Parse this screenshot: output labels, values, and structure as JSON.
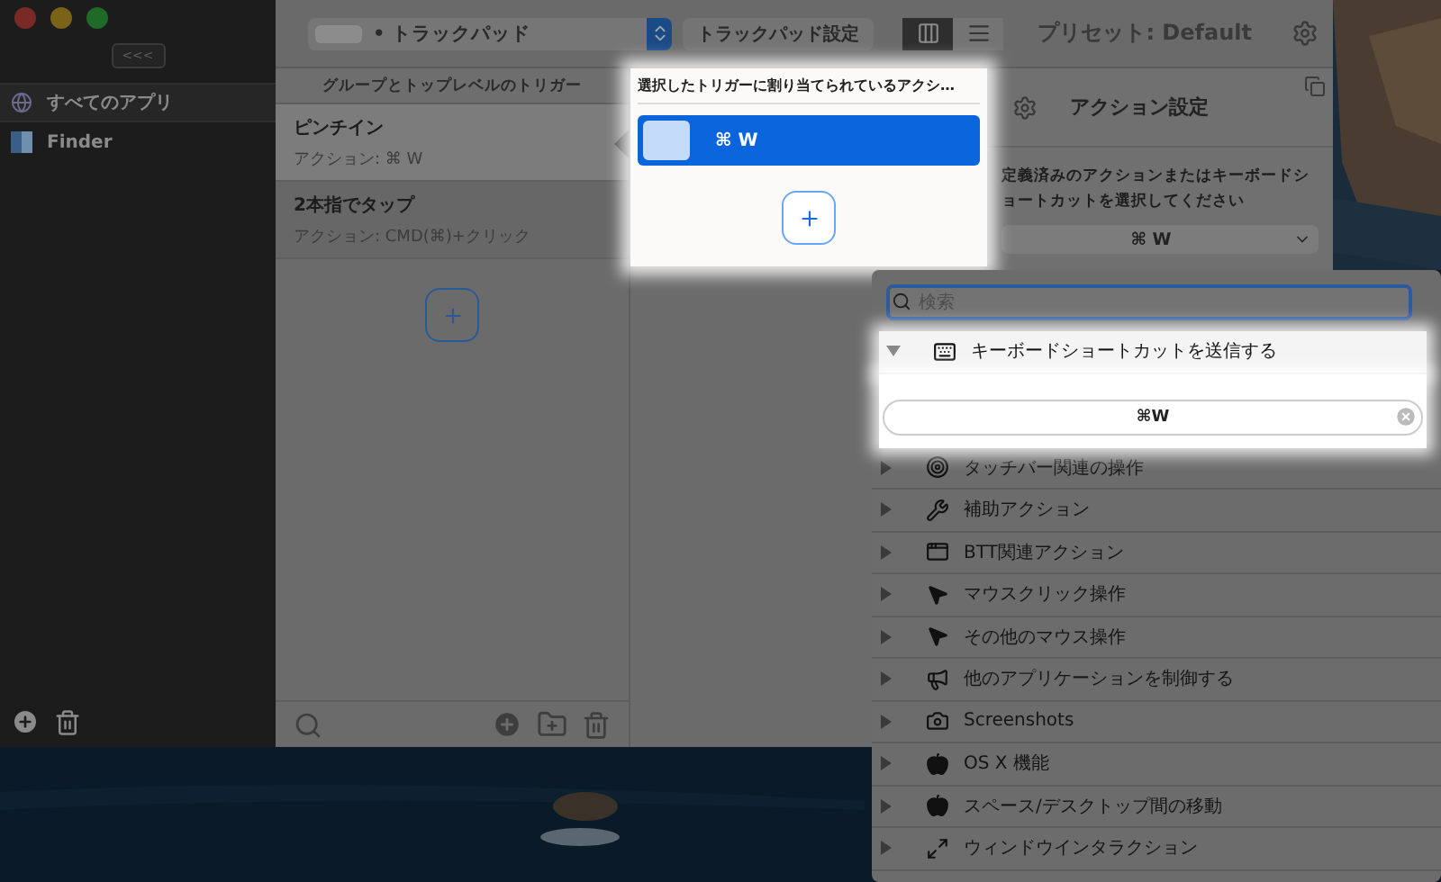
{
  "sidebar": {
    "collapse_button": "<<<",
    "items": [
      {
        "label": "すべてのアプリ",
        "kind": "globe",
        "selected": true
      },
      {
        "label": "Finder",
        "kind": "app",
        "selected": false
      }
    ]
  },
  "toolbar": {
    "device": "• トラックパッド",
    "settings_button": "トラックパッド設定",
    "view_modes": [
      {
        "kind": "columns",
        "selected": true
      },
      {
        "kind": "list",
        "selected": false
      }
    ],
    "preset": "プリセット: Default"
  },
  "triggers": {
    "header": "グループとトップレベルのトリガー",
    "items": [
      {
        "title": "ピンチイン",
        "action": "アクション: ⌘ W",
        "selected": true
      },
      {
        "title": "2本指でタップ",
        "action": "アクション: CMD(⌘)+クリック",
        "selected": false
      }
    ]
  },
  "actions": {
    "header": "選択したトリガーに割り当てられているアクシ…",
    "items": [
      {
        "label": "⌘ W",
        "selected": true
      }
    ]
  },
  "action_settings": {
    "title": "アクション設定",
    "description": "定義済みのアクションまたはキーボードショートカットを選択してください",
    "shortcut": "⌘ W"
  },
  "action_menu": {
    "search_placeholder": "検索",
    "categories": [
      {
        "label": "キーボードショートカットを送信する",
        "kind": "keyboard",
        "expanded": true,
        "shortcut": "⌘W"
      },
      {
        "label": "タッチバー関連の操作",
        "kind": "target",
        "expanded": false
      },
      {
        "label": "補助アクション",
        "kind": "tools",
        "expanded": false
      },
      {
        "label": "BTT関連アクション",
        "kind": "window",
        "expanded": false
      },
      {
        "label": "マウスクリック操作",
        "kind": "pointer",
        "expanded": false
      },
      {
        "label": "その他のマウス操作",
        "kind": "pointer",
        "expanded": false
      },
      {
        "label": "他のアプリケーションを制御する",
        "kind": "megaphone",
        "expanded": false
      },
      {
        "label": "Screenshots",
        "kind": "camera",
        "expanded": false
      },
      {
        "label": "OS X 機能",
        "kind": "apple",
        "expanded": false
      },
      {
        "label": "スペース/デスクトップ間の移動",
        "kind": "apple",
        "expanded": false
      },
      {
        "label": "ウィンドウインタラクション",
        "kind": "resize",
        "expanded": false
      }
    ]
  }
}
